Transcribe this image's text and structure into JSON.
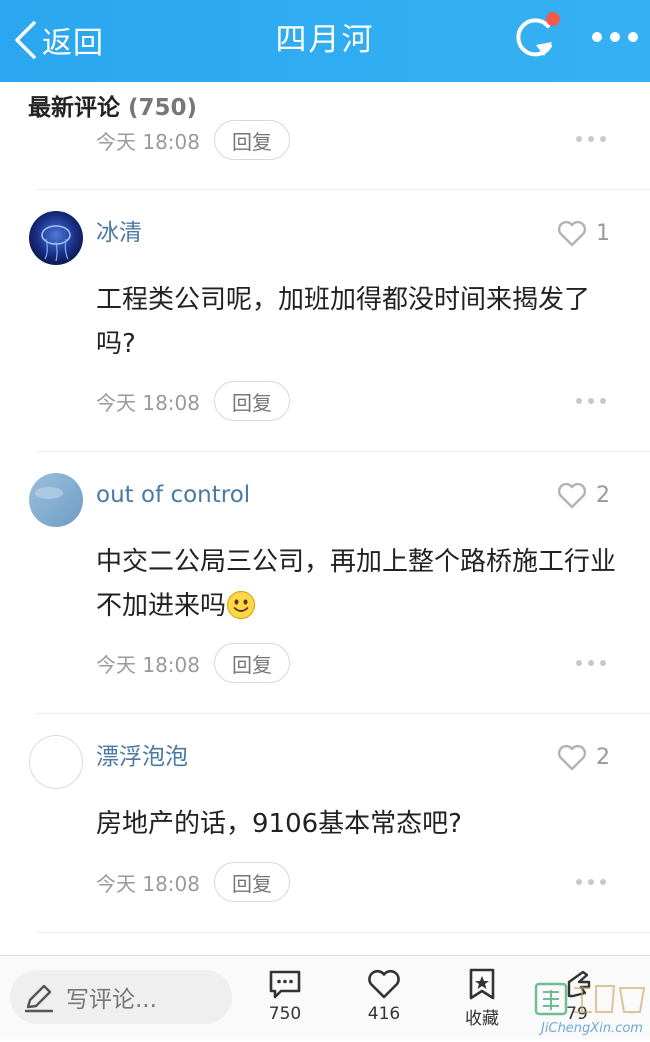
{
  "header": {
    "back_label": "返回",
    "title": "四月河",
    "accent": "#2ea9f1",
    "notification_dot": "#f05a4a"
  },
  "section": {
    "title": "最新评论",
    "count": "(750)"
  },
  "partial_comment": {
    "time": "今天 18:08",
    "reply_label": "回复"
  },
  "comments": [
    {
      "name": "冰清",
      "likes": "1",
      "text": "工程类公司呢，加班加得都没时间来揭发了吗?",
      "time": "今天 18:08",
      "reply_label": "回复",
      "avatar": "blue-jellyfish"
    },
    {
      "name": "out of control",
      "likes": "2",
      "text": "中交二公局三公司，再加上整个路桥施工行业不加进来吗",
      "emoji": "smile-emoji",
      "time": "今天 18:08",
      "reply_label": "回复",
      "avatar": "light-blue-sky"
    },
    {
      "name": "漂浮泡泡",
      "likes": "2",
      "text": "房地产的话，9106基本常态吧?",
      "time": "今天 18:08",
      "reply_label": "回复",
      "avatar": "white-circle"
    }
  ],
  "bottom_bar": {
    "comment_placeholder": "写评论...",
    "comments_count": "750",
    "likes_count": "416",
    "favorite_label": "收藏",
    "share_count": "79"
  },
  "watermark": {
    "text": "JiChengXin.com"
  }
}
